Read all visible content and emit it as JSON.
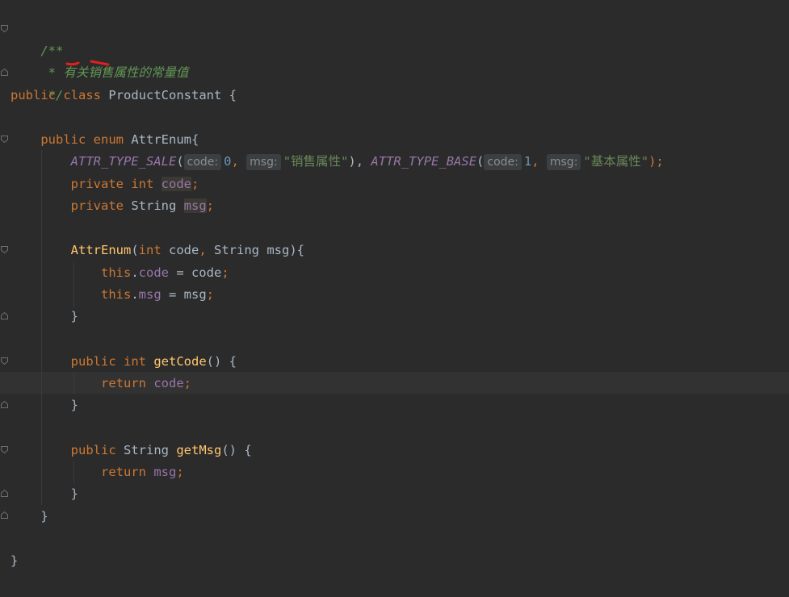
{
  "editor": {
    "filename_class": "ProductConstant",
    "lines": {
      "l1": "/**",
      "l2_star": " * ",
      "l2_text": "有关销售属性的常量值",
      "l3": " */",
      "l4_kw1": "public",
      "l4_kw2": "class",
      "l4_name": "ProductConstant",
      "l4_brace": " {",
      "l6_kw1": "public",
      "l6_kw2": "enum",
      "l6_name": "AttrEnum{",
      "l7_c1": "ATTR_TYPE_SALE",
      "l7_p1": "(",
      "l7_h1": "code:",
      "l7_n1": "0",
      "l7_comma1": ", ",
      "l7_h2": "msg:",
      "l7_s1": "\"销售属性\"",
      "l7_p2": "), ",
      "l7_c2": "ATTR_TYPE_BASE",
      "l7_p3": "(",
      "l7_h3": "code:",
      "l7_n2": "1",
      "l7_comma2": ", ",
      "l7_h4": "msg:",
      "l7_s2": "\"基本属性\"",
      "l7_end": ");",
      "l8_kw1": "private",
      "l8_kw2": "int",
      "l8_field": "code",
      "l9_kw1": "private",
      "l9_type": "String",
      "l9_field": "msg",
      "l11_name": "AttrEnum",
      "l11_kw": "int",
      "l11_rest1": " code",
      "l11_comma": ",",
      "l11_rest2": " String msg){",
      "l12_this": "this",
      "l12_field": "code",
      "l12_rest": " = code",
      "l13_this": "this",
      "l13_field": "msg",
      "l13_rest": " = msg",
      "l14": "}",
      "l16_kw1": "public",
      "l16_kw2": "int",
      "l16_fn": "getCode",
      "l16_rest": "() {",
      "l17_kw": "return",
      "l17_field": "code",
      "l18": "}",
      "l20_kw": "public",
      "l20_type": "String",
      "l20_fn": "getMsg",
      "l20_rest": "() {",
      "l21_kw": "return",
      "l21_field": "msg",
      "l22": "}",
      "l23": "}",
      "l25": "}",
      "semicolon": ";"
    }
  },
  "colors": {
    "background": "#2b2b2b",
    "keyword": "#cc7832",
    "comment": "#629755",
    "field": "#9876aa",
    "function": "#ffc66d",
    "number": "#6897bb",
    "string": "#6a8759",
    "text": "#a9b7c6",
    "annotation_mark": "#e02020"
  }
}
